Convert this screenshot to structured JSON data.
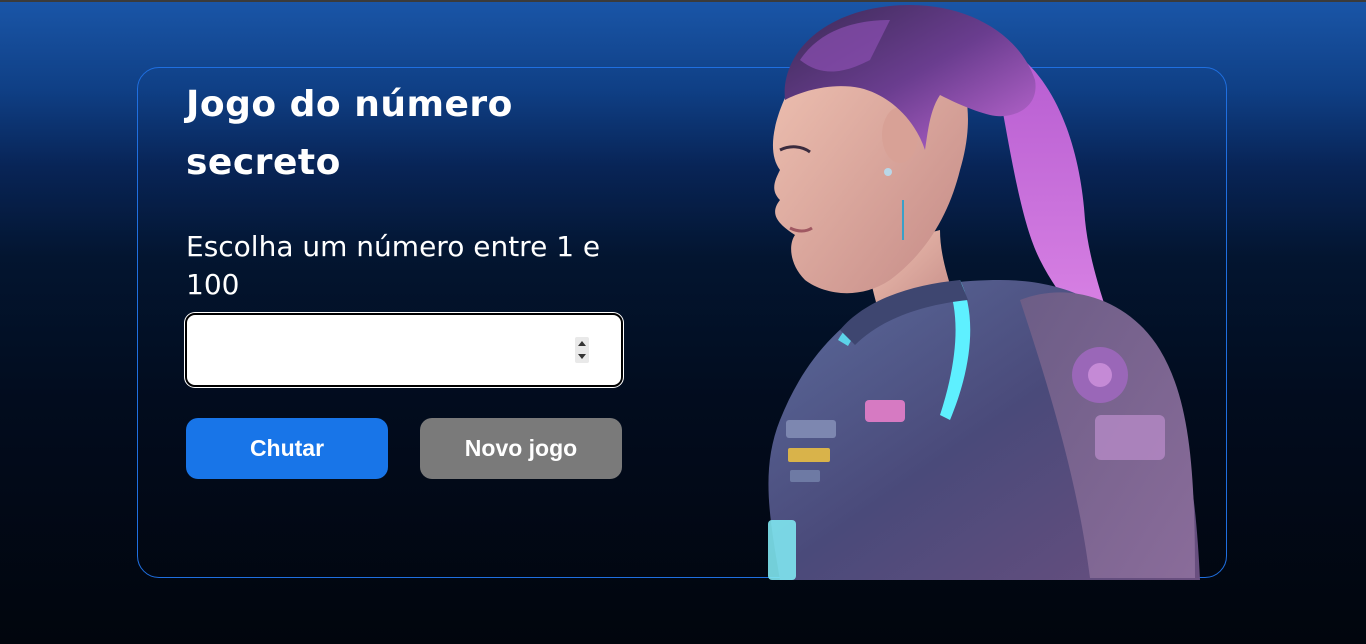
{
  "game": {
    "title_line1": "Jogo do número",
    "title_line2": "secreto",
    "subtitle": "Escolha um número entre 1 e 100",
    "input": {
      "value": "",
      "placeholder": ""
    },
    "buttons": {
      "guess_label": "Chutar",
      "new_game_label": "Novo jogo"
    }
  },
  "theme": {
    "primary_button": "#1875e8",
    "secondary_button": "#7a7a7a",
    "border_accent": "#1f6fe0"
  },
  "illustration": {
    "icon": "cyberpunk-girl-illustration"
  }
}
